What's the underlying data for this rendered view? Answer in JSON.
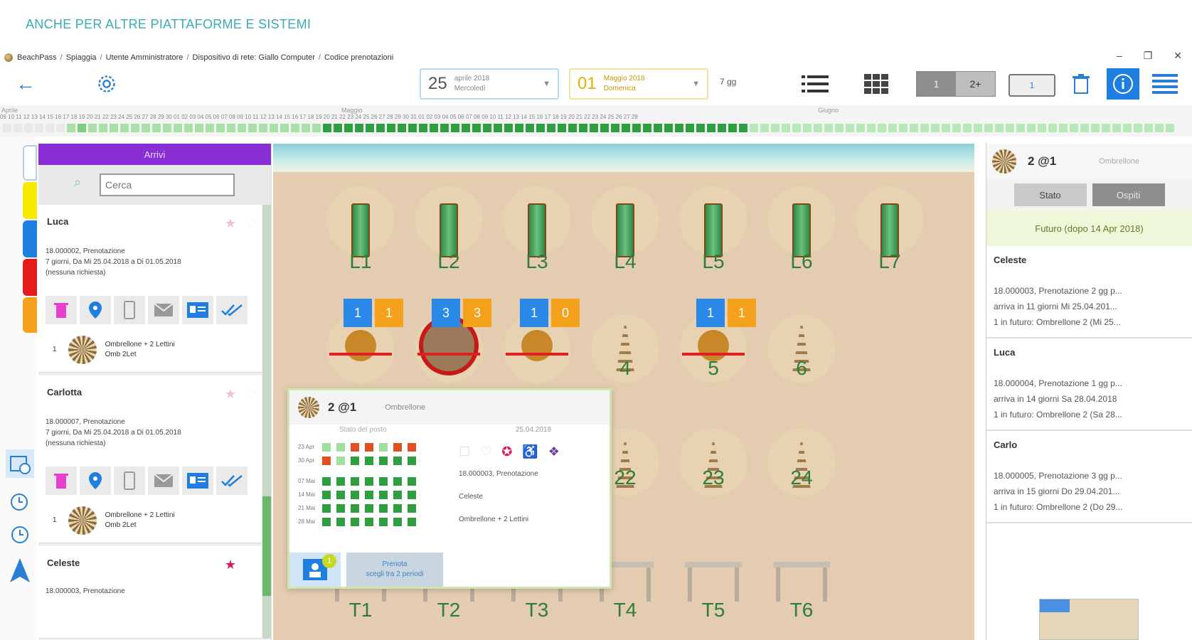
{
  "promo": "ANCHE PER ALTRE PIATTAFORME E SISTEMI",
  "breadcrumb": [
    "BeachPass",
    "Spiaggia",
    "Utente Amministratore",
    "Dispositivo di rete: Giallo Computer",
    "Codice prenotazioni"
  ],
  "window": {
    "minimize": "–",
    "restore": "❐",
    "close": "✕"
  },
  "toolbar": {
    "date_from": {
      "day": "25",
      "month": "aprile 2018",
      "weekday": "Mercoledì"
    },
    "date_to": {
      "day": "01",
      "month": "Maggio 2018",
      "weekday": "Domenica"
    },
    "duration": "7 gg",
    "seg": [
      "1",
      "2+"
    ],
    "mini": "1"
  },
  "timeline": {
    "months": [
      "Aprile",
      "Maggio",
      "Giugno"
    ],
    "days": "09 10 11 12 13 14 15 16 17 18 19 20 21 22 23 24 25 26 27 28 29 30    01 02 03 04 05 06 07 08 09 10 11 12 13 14 15 16 17 18 19 20 21 22 23 24 25 26 27 28 29 30 31    01 02 03 04 05 06 07 08 09 10 11 12 13 14 15 16 17 18 19 20 21 22 23 24 25 26 27 28"
  },
  "list": {
    "header": "Arrivi",
    "search_placeholder": "Cerca",
    "cards": [
      {
        "name": "Luca",
        "desc": "18.000002, Prenotazione\n7 giorni, Da Mi 25.04.2018 a Di 01.05.2018\n(nessuna richiesta)",
        "item": "Ombrellone + 2 Lettini\nOmb 2Let",
        "qty": "1"
      },
      {
        "name": "Carlotta",
        "desc": "18.000007, Prenotazione\n7 giorni, Da Mi 25.04.2018 a Di 01.05.2018\n(nessuna richiesta)",
        "item": "Ombrellone + 2 Lettini\nOmb 2Let",
        "qty": "1"
      },
      {
        "name": "Celeste",
        "desc": "18.000003, Prenotazione"
      }
    ]
  },
  "beach": {
    "lettini": [
      "L1",
      "L2",
      "L3",
      "L4",
      "L5",
      "L6",
      "L7"
    ],
    "tags": [
      {
        "b": "1",
        "o": "1"
      },
      {
        "b": "3",
        "o": "3"
      },
      {
        "b": "1",
        "o": "0"
      },
      {
        "b": "1",
        "o": "1"
      }
    ],
    "row2": [
      "4",
      "5",
      "6"
    ],
    "row3": [
      "22",
      "23",
      "24"
    ],
    "gazebo": [
      "T1",
      "T2",
      "T3",
      "T4",
      "T5",
      "T6"
    ]
  },
  "popup": {
    "title": "2 @1",
    "subtitle": "Ombrellone",
    "state_label": "Stato del posto",
    "date": "25.04.2018",
    "rows": [
      "23 Apr",
      "30 Apr",
      "07 Mai",
      "14 Mai",
      "21 Mai",
      "28 Mai"
    ],
    "booking": "18.000003, Prenotazione",
    "customer": "Celeste",
    "product": "Ombrellone + 2 Lettini",
    "badge": "1",
    "more_btn": [
      "Prenota",
      "scegli tra 2 periodi"
    ]
  },
  "right": {
    "title": "2 @1",
    "subtitle": "Ombrellone",
    "tabs": [
      "Stato",
      "Ospiti"
    ],
    "future": "Futuro (dopo 14 Apr 2018)",
    "items": [
      {
        "name": "Celeste",
        "desc": "18.000003, Prenotazione 2 gg p...\narriva in 11 giorni Mi 25.04.201...\n1 in futuro: Ombrellone 2 (Mi 25..."
      },
      {
        "name": "Luca",
        "desc": "18.000004, Prenotazione 1 gg p...\narriva in 14 giorni Sa 28.04.2018\n1 in futuro: Ombrellone 2 (Sa 28..."
      },
      {
        "name": "Carlo",
        "desc": "18.000005, Prenotazione 3 gg p...\narriva in 15 giorni Do 29.04.201...\n1 in futuro: Ombrellone 2 (Do 29..."
      }
    ]
  },
  "colors": {
    "accent": "#1f7fe0",
    "purple": "#8a2fd6",
    "green": "#2e9e3e",
    "orange": "#f4a11c",
    "red": "#e02020"
  }
}
